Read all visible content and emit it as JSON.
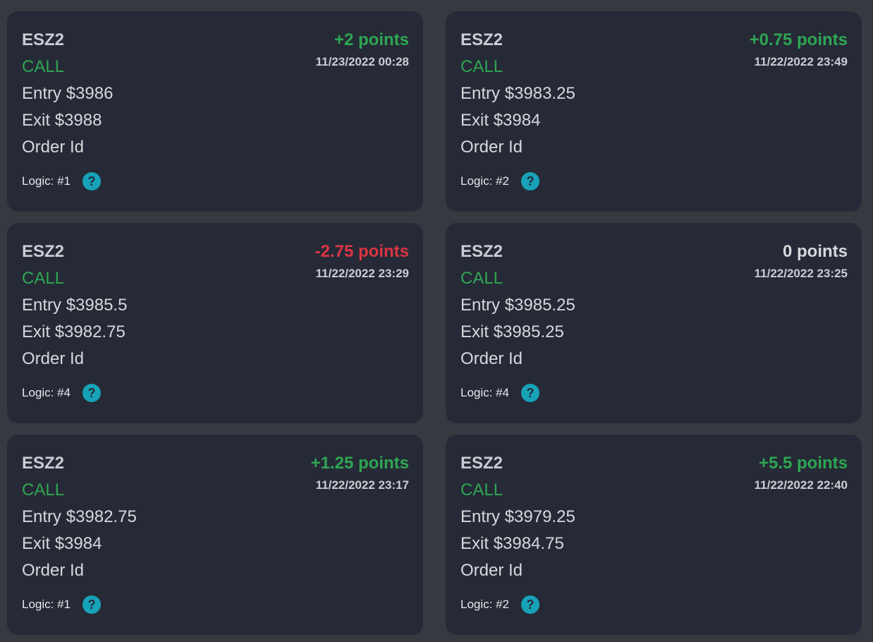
{
  "colors": {
    "positive": "#2ea653",
    "negative": "#dc3545",
    "neutral": "#d6d8dc",
    "help_icon": "#17a2b8"
  },
  "labels": {
    "entry_prefix": "Entry ",
    "exit_prefix": "Exit ",
    "order_id": "Order Id",
    "logic_prefix": "Logic: "
  },
  "trades": [
    {
      "symbol": "ESZ2",
      "side": "CALL",
      "points": "+2 points",
      "status": "positive",
      "date": "11/23/2022 00:28",
      "entry": "$3986",
      "exit": "$3988",
      "logic": "#1",
      "help_icon": "question-circle-icon"
    },
    {
      "symbol": "ESZ2",
      "side": "CALL",
      "points": "+0.75 points",
      "status": "positive",
      "date": "11/22/2022 23:49",
      "entry": "$3983.25",
      "exit": "$3984",
      "logic": "#2",
      "help_icon": "question-circle-icon"
    },
    {
      "symbol": "ESZ2",
      "side": "CALL",
      "points": "-2.75 points",
      "status": "negative",
      "date": "11/22/2022 23:29",
      "entry": "$3985.5",
      "exit": "$3982.75",
      "logic": "#4",
      "help_icon": "question-circle-icon"
    },
    {
      "symbol": "ESZ2",
      "side": "CALL",
      "points": "0 points",
      "status": "neutral",
      "date": "11/22/2022 23:25",
      "entry": "$3985.25",
      "exit": "$3985.25",
      "logic": "#4",
      "help_icon": "question-circle-icon"
    },
    {
      "symbol": "ESZ2",
      "side": "CALL",
      "points": "+1.25 points",
      "status": "positive",
      "date": "11/22/2022 23:17",
      "entry": "$3982.75",
      "exit": "$3984",
      "logic": "#1",
      "help_icon": "question-circle-icon"
    },
    {
      "symbol": "ESZ2",
      "side": "CALL",
      "points": "+5.5 points",
      "status": "positive",
      "date": "11/22/2022 22:40",
      "entry": "$3979.25",
      "exit": "$3984.75",
      "logic": "#2",
      "help_icon": "question-circle-icon"
    }
  ]
}
